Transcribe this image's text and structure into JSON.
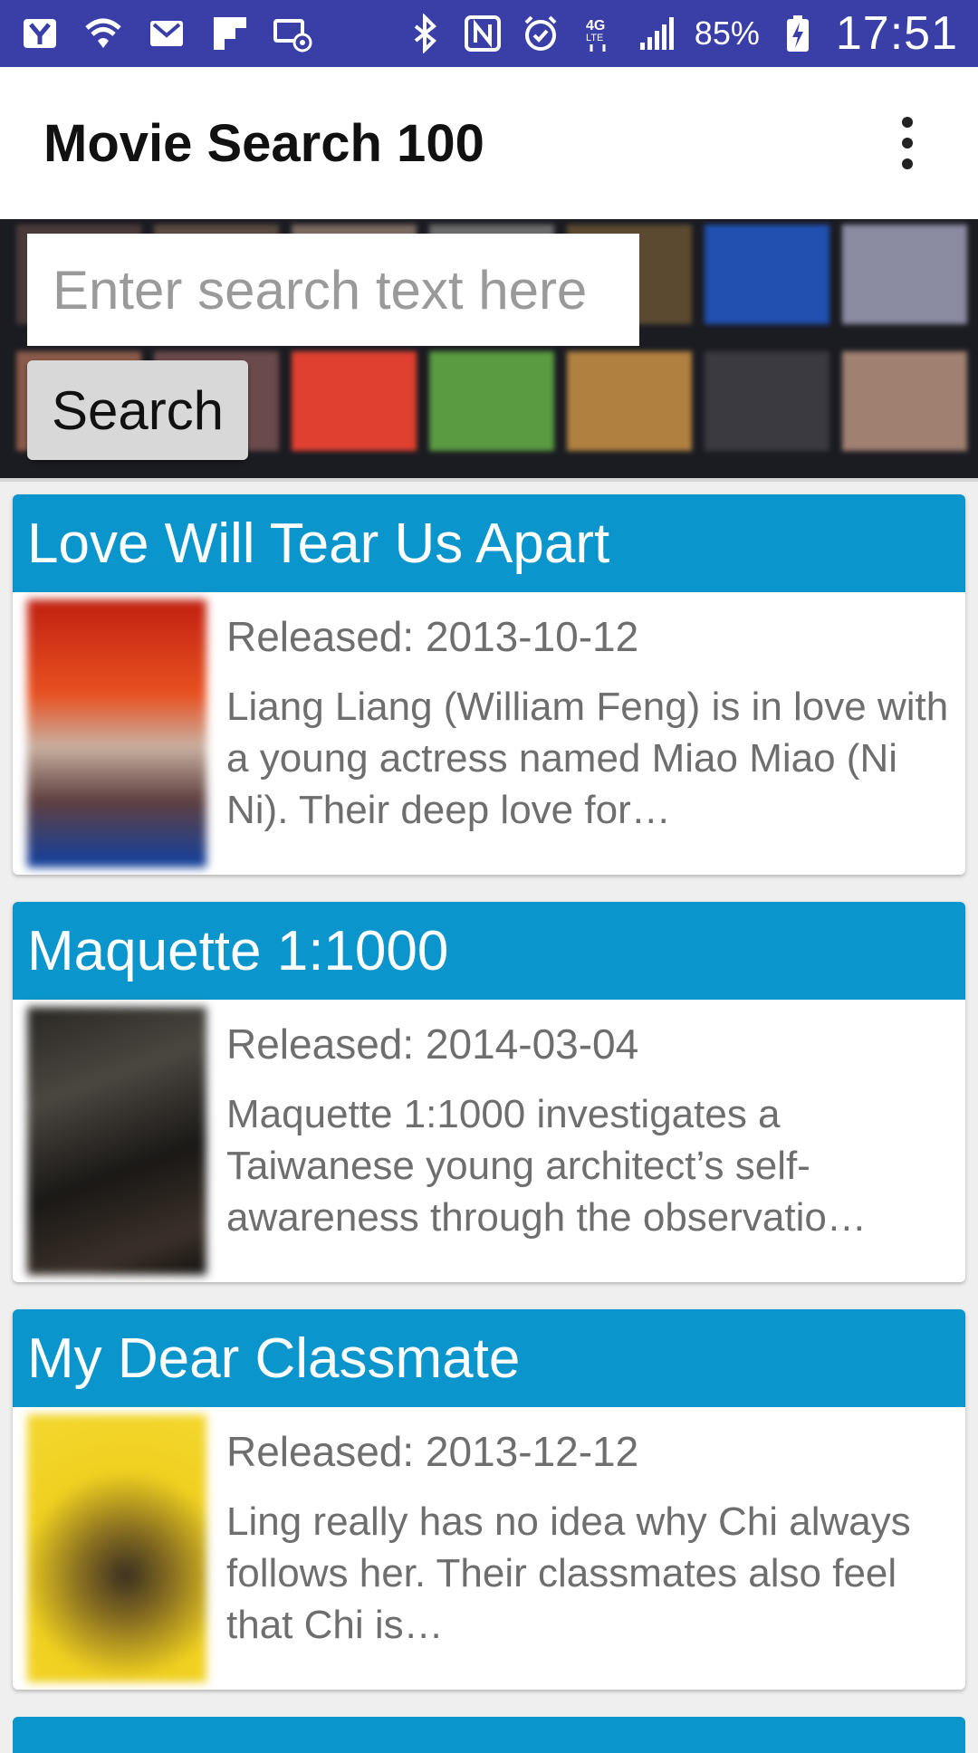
{
  "status_bar": {
    "icons": [
      "yahoo-icon",
      "wifi-icon",
      "mail-icon",
      "flipboard-icon",
      "email-at-icon",
      "bluetooth-icon",
      "nfc-icon",
      "alarm-icon",
      "4g-lte-icon",
      "signal-icon"
    ],
    "battery": "85%",
    "time": "17:51"
  },
  "app_bar": {
    "title": "Movie Search 100",
    "menu_icon": "more-vert-icon"
  },
  "search": {
    "placeholder": "Enter search text here",
    "value": "",
    "button_label": "Search"
  },
  "colors": {
    "status_bar": "#3a3fa8",
    "card_header": "#0a96cc",
    "text_secondary": "#6e6e6e"
  },
  "movies": [
    {
      "title": "Love Will Tear Us Apart",
      "released": "Released: 2013-10-12",
      "overview": "Liang Liang (William Feng) is in love with a young actress named Miao Miao (Ni Ni). Their deep love for…"
    },
    {
      "title": "Maquette 1:1000",
      "released": "Released: 2014-03-04",
      "overview": "Maquette 1:1000 investigates a Taiwanese young architect’s self-awareness through the observatio…"
    },
    {
      "title": "My Dear Classmate",
      "released": "Released: 2013-12-12",
      "overview": "Ling really has no idea why Chi always follows her. Their classmates also feel that Chi is…"
    }
  ]
}
